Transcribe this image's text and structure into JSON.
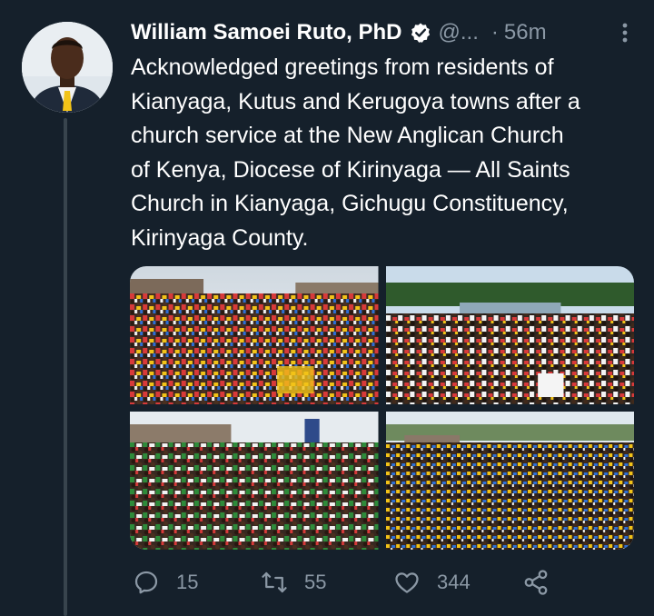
{
  "author": {
    "name": "William Samoei Ruto, PhD",
    "handle": "@...",
    "separator": "·",
    "time": "56m"
  },
  "tweet": {
    "text": "Acknowledged greetings from residents of\nKianyaga, Kutus and Kerugoya towns after a\nchurch service at the New Anglican Church\nof Kenya, Diocese  of Kirinyaga — All Saints\nChurch in Kianyaga, Gichugu Constituency,\nKirinyaga County."
  },
  "actions": {
    "replies": "15",
    "retweets": "55",
    "likes": "344"
  },
  "colors": {
    "background": "#15202b",
    "text": "#ffffff",
    "secondary": "#8b98a5",
    "thread_line": "#38444d"
  },
  "icons": [
    "verified-badge-icon",
    "more-options-icon",
    "reply-icon",
    "retweet-icon",
    "like-icon",
    "share-icon"
  ]
}
